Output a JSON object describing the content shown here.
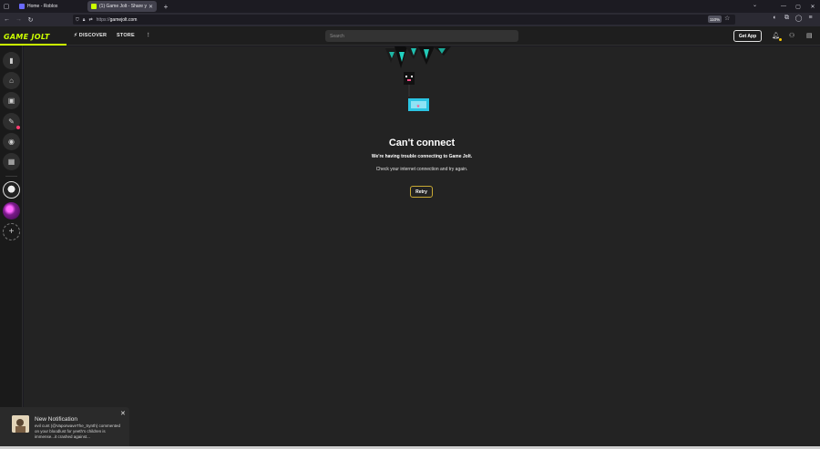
{
  "browser": {
    "tabs": [
      {
        "title": "Home - Roblox",
        "active": false,
        "favicon_color": "#6a6aff"
      },
      {
        "title": "(1) Game Jolt - Share your crea",
        "active": true,
        "favicon_color": "#ccff00"
      }
    ],
    "url_protocol": "https://",
    "url_host": "gamejolt.com",
    "zoom": "110%"
  },
  "site": {
    "logo": "GAME JOLT",
    "nav": {
      "discover": "DISCOVER",
      "store": "STORE",
      "more": "⋮"
    },
    "search_placeholder": "Search",
    "get_app": "Get App"
  },
  "error": {
    "title": "Can't connect",
    "subtitle": "We're having trouble connecting to Game Jolt.",
    "hint": "Check your internet connection and try again.",
    "retry": "Retry"
  },
  "notification": {
    "title": "New Notification",
    "message": "evil cunt (@VaporwaveThe_Synth) commented on your bloodlust for yeeth's children is immense...it crashed against..."
  },
  "colors": {
    "brand": "#ccff00",
    "retry_border": "#c8a934",
    "notif_dot": "#ff3d71"
  }
}
